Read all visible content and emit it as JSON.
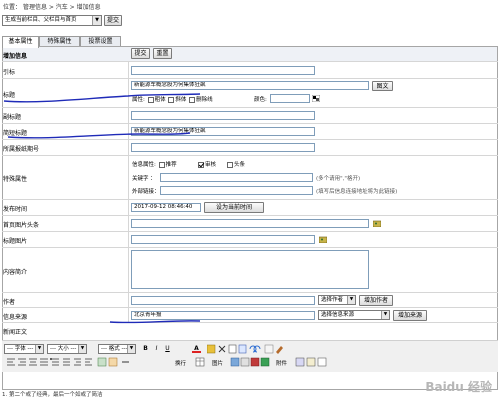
{
  "breadcrumb": {
    "location_label": "位置：",
    "path": "管理信息 > 汽车 > 增加信息"
  },
  "top_bar": {
    "select_value": "生成当前栏目、父栏目与首页",
    "submit_label": "提交"
  },
  "tabs": [
    "基本属性",
    "特殊属性",
    "投票设置"
  ],
  "section_title": "增加信息",
  "form_actions": {
    "submit_label": "提交",
    "reset_label": "重置"
  },
  "fields": {
    "citation": {
      "label": "引标",
      "value": ""
    },
    "title": {
      "label": "标题",
      "value": "新能源车概念股为何集体狂飙",
      "image_button": "图文",
      "attr_label": "属性:",
      "bold": "粗体",
      "italic": "斜体",
      "strike": "删除线",
      "color_label": "颜色:"
    },
    "subtitle": {
      "label": "副标题",
      "value": ""
    },
    "short_title": {
      "label": "简短标题",
      "value": "新能源车概念股为何集体狂飙"
    },
    "paper_issue": {
      "label": "所属报纸期号",
      "value": ""
    },
    "special_attr": {
      "label": "特殊属性",
      "info_attr_label": "信息属性:",
      "recommend": "推荐",
      "review": "审核",
      "headline": "头条",
      "keywords_label": "关键字 ：",
      "keywords_value": "",
      "keywords_note": "(多个请用\",\"格开)",
      "external_link_label": "外部链接：",
      "external_link_value": "",
      "external_link_note": "(填写后信息连接地址将为此链接)"
    },
    "publish_time": {
      "label": "发布时间",
      "value": "2017-09-12 08:46:40",
      "button": "设为当前时间"
    },
    "home_image": {
      "label": "首页图片头条",
      "value": ""
    },
    "title_image": {
      "label": "标题图片",
      "value": ""
    },
    "summary": {
      "label": "内容简介",
      "value": ""
    },
    "author": {
      "label": "作者",
      "value": "",
      "select": "选择作者",
      "add_button": "增加作者"
    },
    "source": {
      "label": "信息来源",
      "value": "北京青年报",
      "select": "选择信息来源",
      "add_button": "增加来源"
    },
    "body": {
      "label": "新闻正文"
    }
  },
  "toolbar": {
    "font_family": "--- 字体 ---",
    "font_size": "--- 大小 ---",
    "format": "--- 格式 ---",
    "buttons": [
      "B",
      "I",
      "U",
      "A"
    ],
    "labels": {
      "line_break": "换行",
      "image": "图片",
      "attachment": "附件"
    }
  },
  "footer_text": "1. 第二个或了经典，最后一个如或了简洁",
  "watermark": "Baidu 经验",
  "colors": {
    "pen": "#1f2bb8",
    "border": "#a6a6a6",
    "tab_bg": "#e9ecf1"
  },
  "icons": [
    "color-picker-icon",
    "image-picker-icon",
    "editor-toolbar-icons"
  ]
}
